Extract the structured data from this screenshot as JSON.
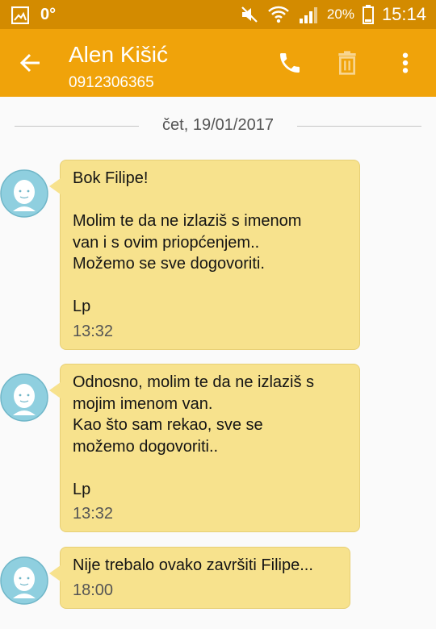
{
  "status_bar": {
    "temperature": "0°",
    "battery_percent": "20%",
    "time": "15:14",
    "icons": [
      "image-icon",
      "mute-icon",
      "wifi-icon",
      "signal-icon",
      "battery-icon"
    ]
  },
  "header": {
    "contact_name": "Alen Kišić",
    "contact_number": "0912306365",
    "icons": [
      "back-arrow-icon",
      "phone-icon",
      "trash-icon",
      "more-vertical-icon"
    ]
  },
  "thread": {
    "date_label": "čet, 19/01/2017",
    "messages": [
      {
        "text": "Bok Filipe!\n\nMolim te da ne izlaziš s imenom\nvan i s ovim priopćenjem..\nMožemo se sve dogovoriti.\n\nLp",
        "time": "13:32"
      },
      {
        "text": "Odnosno, molim te da ne izlaziš s\nmojim imenom van.\nKao što sam rekao, sve se\nmožemo dogovoriti..\n\nLp",
        "time": "13:32"
      },
      {
        "text": "Nije trebalo ovako završiti Filipe...",
        "time": "18:00"
      }
    ]
  },
  "colors": {
    "status_bar": "#d38b00",
    "app_bar": "#f0a30a",
    "bubble": "#f7e28d",
    "avatar": "#8fcfdf",
    "background": "#fafafa"
  }
}
